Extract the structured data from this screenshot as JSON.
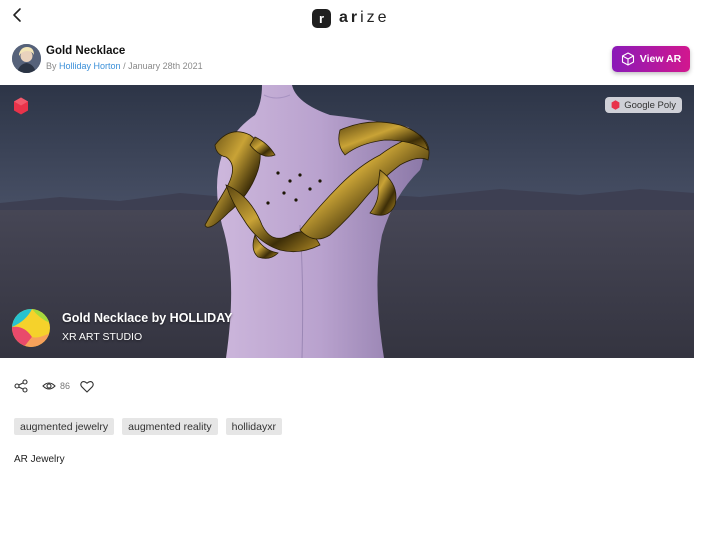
{
  "header": {
    "back_icon": "chevron-left-icon",
    "logo_mark": "r",
    "logo_text_bold": "ar",
    "logo_text_rest": "ize"
  },
  "post": {
    "title": "Gold Necklace",
    "by_prefix": "By",
    "author": "Holliday Horton",
    "separator": "/",
    "date": "January 28th 2021",
    "view_ar_label": "View AR",
    "view_ar_icon": "ar-cube-icon"
  },
  "model": {
    "source_badge": "Google Poly",
    "title": "Gold Necklace by HOLLIDAY",
    "studio": "XR ART STUDIO"
  },
  "actions": {
    "share_icon": "share-icon",
    "views_icon": "eye-icon",
    "views_count": "86",
    "like_icon": "heart-icon"
  },
  "tags": [
    "augmented jewelry",
    "augmented reality",
    "hollidayxr"
  ],
  "category": "AR Jewelry",
  "colors": {
    "accent_gradient_start": "#8a1ab8",
    "accent_gradient_end": "#d2178e",
    "author_link": "#3a8fd8",
    "poly_red": "#e8334a"
  }
}
